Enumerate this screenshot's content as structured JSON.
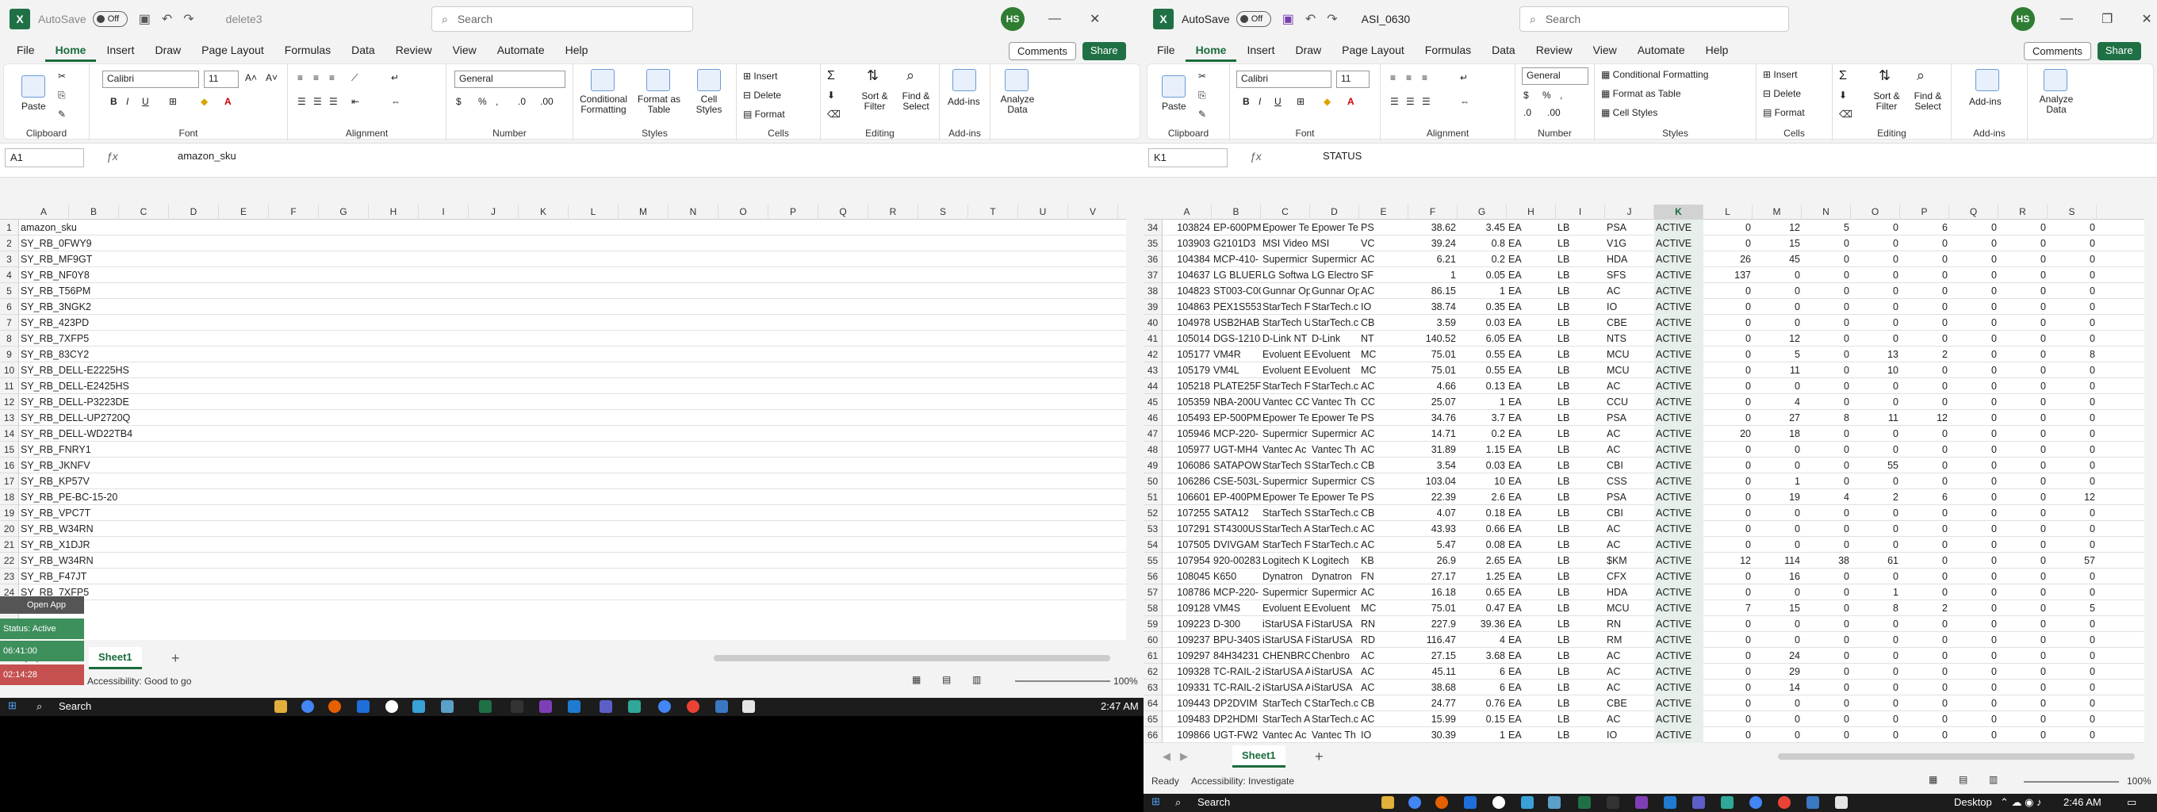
{
  "left_window": {
    "autosave_label": "AutoSave",
    "autosave_state": "Off",
    "filename": "delete3",
    "search_placeholder": "Search",
    "avatar": "HS",
    "menu": [
      "File",
      "Home",
      "Insert",
      "Draw",
      "Page Layout",
      "Formulas",
      "Data",
      "Review",
      "View",
      "Automate",
      "Help"
    ],
    "comments": "Comments",
    "share": "Share",
    "ribbon": {
      "paste": "Paste",
      "font_name": "Calibri",
      "font_size": "11",
      "number_format": "General",
      "cond_format": "Conditional Formatting",
      "format_table": "Format as Table",
      "cell_styles": "Cell Styles",
      "insert": "Insert",
      "delete": "Delete",
      "format": "Format",
      "sort_filter": "Sort & Filter",
      "find_select": "Find & Select",
      "addins": "Add-ins",
      "analyze": "Analyze Data",
      "groups": [
        "Clipboard",
        "Font",
        "Alignment",
        "Number",
        "Styles",
        "Cells",
        "Editing",
        "Add-ins"
      ]
    },
    "namebox": "A1",
    "formula": "amazon_sku",
    "columns": [
      "A",
      "B",
      "C",
      "D",
      "E",
      "F",
      "G",
      "H",
      "I",
      "J",
      "K",
      "L",
      "M",
      "N",
      "O",
      "P",
      "Q",
      "R",
      "S",
      "T",
      "U",
      "V"
    ],
    "rows": [
      "amazon_sku",
      "SY_RB_0FWY9",
      "SY_RB_MF9GT",
      "SY_RB_NF0Y8",
      "SY_RB_T56PM",
      "SY_RB_3NGK2",
      "SY_RB_423PD",
      "SY_RB_7XFP5",
      "SY_RB_83CY2",
      "SY_RB_DELL-E2225HS",
      "SY_RB_DELL-E2425HS",
      "SY_RB_DELL-P3223DE",
      "SY_RB_DELL-UP2720Q",
      "SY_RB_DELL-WD22TB4",
      "SY_RB_FNRY1",
      "SY_RB_JKNFV",
      "SY_RB_KP57V",
      "SY_RB_PE-BC-15-20",
      "SY_RB_VPC7T",
      "SY_RB_W34RN",
      "SY_RB_X1DJR",
      "SY_RB_W34RN",
      "SY_RB_F47JT",
      "SY_RB_7XFP5"
    ],
    "sheet_tab": "Sheet1",
    "accessibility": "Accessibility: Good to go",
    "zoom": "100%",
    "taskbar_search": "Search",
    "clock": "2:47 AM",
    "overlay_open": "Open App",
    "overlay_status": "Status: Active",
    "overlay_time1": "06:41:00",
    "overlay_time2": "02:14:28"
  },
  "right_window": {
    "autosave_label": "AutoSave",
    "autosave_state": "Off",
    "filename": "ASI_0630",
    "search_placeholder": "Search",
    "avatar": "HS",
    "menu": [
      "File",
      "Home",
      "Insert",
      "Draw",
      "Page Layout",
      "Formulas",
      "Data",
      "Review",
      "View",
      "Automate",
      "Help"
    ],
    "comments": "Comments",
    "share": "Share",
    "ribbon": {
      "paste": "Paste",
      "font_name": "Calibri",
      "font_size": "11",
      "number_format": "General",
      "cond_format": "Conditional Formatting",
      "format_table": "Format as Table",
      "cell_styles": "Cell Styles",
      "insert": "Insert",
      "delete": "Delete",
      "format": "Format",
      "sort_filter": "Sort & Filter",
      "find_select": "Find & Select",
      "addins": "Add-ins",
      "analyze": "Analyze Data",
      "groups": [
        "Clipboard",
        "Font",
        "Alignment",
        "Number",
        "Styles",
        "Cells",
        "Editing",
        "Add-ins"
      ]
    },
    "namebox": "K1",
    "formula": "STATUS",
    "columns": [
      "A",
      "B",
      "C",
      "D",
      "E",
      "F",
      "G",
      "H",
      "I",
      "J",
      "K",
      "L",
      "M",
      "N",
      "O",
      "P",
      "Q",
      "R",
      "S"
    ],
    "row_numbers": [
      34,
      35,
      36,
      37,
      38,
      39,
      40,
      41,
      42,
      43,
      44,
      45,
      46,
      47,
      48,
      49,
      50,
      51,
      52,
      53,
      54,
      55,
      56,
      57,
      58,
      59,
      60,
      61,
      62,
      63,
      64,
      65,
      66
    ],
    "rows": [
      [
        "103824",
        "EP-600PM",
        "Epower Te",
        "Epower Te",
        "PS",
        "38.62",
        "3.45",
        "EA",
        "LB",
        "PSA",
        "ACTIVE",
        "0",
        "12",
        "5",
        "0",
        "6",
        "0",
        "0",
        "0"
      ],
      [
        "103903",
        "G2101D3",
        "MSI Video",
        "MSI",
        "VC",
        "39.24",
        "0.8",
        "EA",
        "LB",
        "V1G",
        "ACTIVE",
        "0",
        "15",
        "0",
        "0",
        "0",
        "0",
        "0",
        "0"
      ],
      [
        "104384",
        "MCP-410-",
        "Supermicr",
        "Supermicr",
        "AC",
        "6.21",
        "0.2",
        "EA",
        "LB",
        "HDA",
        "ACTIVE",
        "26",
        "45",
        "0",
        "0",
        "0",
        "0",
        "0",
        "0"
      ],
      [
        "104637",
        "LG BLUERA",
        "LG Softwa",
        "LG Electro",
        "SF",
        "1",
        "0.05",
        "EA",
        "LB",
        "SFS",
        "ACTIVE",
        "137",
        "0",
        "0",
        "0",
        "0",
        "0",
        "0",
        "0"
      ],
      [
        "104823",
        "ST003-C00",
        "Gunnar Op",
        "Gunnar Op",
        "AC",
        "86.15",
        "1",
        "EA",
        "LB",
        "AC",
        "ACTIVE",
        "0",
        "0",
        "0",
        "0",
        "0",
        "0",
        "0",
        "0"
      ],
      [
        "104863",
        "PEX1S553",
        "StarTech F",
        "StarTech.c",
        "IO",
        "38.74",
        "0.35",
        "EA",
        "LB",
        "IO",
        "ACTIVE",
        "0",
        "0",
        "0",
        "0",
        "0",
        "0",
        "0",
        "0"
      ],
      [
        "104978",
        "USB2HAB",
        "StarTech U",
        "StarTech.c",
        "CB",
        "3.59",
        "0.03",
        "EA",
        "LB",
        "CBE",
        "ACTIVE",
        "0",
        "0",
        "0",
        "0",
        "0",
        "0",
        "0",
        "0"
      ],
      [
        "105014",
        "DGS-1210-",
        "D-Link NT",
        "D-Link",
        "NT",
        "140.52",
        "6.05",
        "EA",
        "LB",
        "NTS",
        "ACTIVE",
        "0",
        "12",
        "0",
        "0",
        "0",
        "0",
        "0",
        "0"
      ],
      [
        "105177",
        "VM4R",
        "Evoluent E",
        "Evoluent",
        "MC",
        "75.01",
        "0.55",
        "EA",
        "LB",
        "MCU",
        "ACTIVE",
        "0",
        "5",
        "0",
        "13",
        "2",
        "0",
        "0",
        "8"
      ],
      [
        "105179",
        "VM4L",
        "Evoluent E",
        "Evoluent",
        "MC",
        "75.01",
        "0.55",
        "EA",
        "LB",
        "MCU",
        "ACTIVE",
        "0",
        "11",
        "0",
        "10",
        "0",
        "0",
        "0",
        "0"
      ],
      [
        "105218",
        "PLATE25F",
        "StarTech F",
        "StarTech.c",
        "AC",
        "4.66",
        "0.13",
        "EA",
        "LB",
        "AC",
        "ACTIVE",
        "0",
        "0",
        "0",
        "0",
        "0",
        "0",
        "0",
        "0"
      ],
      [
        "105359",
        "NBA-200U",
        "Vantec CC",
        "Vantec Th",
        "CC",
        "25.07",
        "1",
        "EA",
        "LB",
        "CCU",
        "ACTIVE",
        "0",
        "4",
        "0",
        "0",
        "0",
        "0",
        "0",
        "0"
      ],
      [
        "105493",
        "EP-500PM",
        "Epower Te",
        "Epower Te",
        "PS",
        "34.76",
        "3.7",
        "EA",
        "LB",
        "PSA",
        "ACTIVE",
        "0",
        "27",
        "8",
        "11",
        "12",
        "0",
        "0",
        "0"
      ],
      [
        "105946",
        "MCP-220-",
        "Supermicr",
        "Supermicr",
        "AC",
        "14.71",
        "0.2",
        "EA",
        "LB",
        "AC",
        "ACTIVE",
        "20",
        "18",
        "0",
        "0",
        "0",
        "0",
        "0",
        "0"
      ],
      [
        "105977",
        "UGT-MH4",
        "Vantec Ac",
        "Vantec Th",
        "AC",
        "31.89",
        "1.15",
        "EA",
        "LB",
        "AC",
        "ACTIVE",
        "0",
        "0",
        "0",
        "0",
        "0",
        "0",
        "0",
        "0"
      ],
      [
        "106086",
        "SATAPOW",
        "StarTech S",
        "StarTech.c",
        "CB",
        "3.54",
        "0.03",
        "EA",
        "LB",
        "CBI",
        "ACTIVE",
        "0",
        "0",
        "0",
        "55",
        "0",
        "0",
        "0",
        "0"
      ],
      [
        "106286",
        "CSE-503L-",
        "Supermicr",
        "Supermicr",
        "CS",
        "103.04",
        "10",
        "EA",
        "LB",
        "CSS",
        "ACTIVE",
        "0",
        "1",
        "0",
        "0",
        "0",
        "0",
        "0",
        "0"
      ],
      [
        "106601",
        "EP-400PM",
        "Epower Te",
        "Epower Te",
        "PS",
        "22.39",
        "2.6",
        "EA",
        "LB",
        "PSA",
        "ACTIVE",
        "0",
        "19",
        "4",
        "2",
        "6",
        "0",
        "0",
        "12"
      ],
      [
        "107255",
        "SATA12",
        "StarTech S",
        "StarTech.c",
        "CB",
        "4.07",
        "0.18",
        "EA",
        "LB",
        "CBI",
        "ACTIVE",
        "0",
        "0",
        "0",
        "0",
        "0",
        "0",
        "0",
        "0"
      ],
      [
        "107291",
        "ST4300USI",
        "StarTech A",
        "StarTech.c",
        "AC",
        "43.93",
        "0.66",
        "EA",
        "LB",
        "AC",
        "ACTIVE",
        "0",
        "0",
        "0",
        "0",
        "0",
        "0",
        "0",
        "0"
      ],
      [
        "107505",
        "DVIVGAM",
        "StarTech F",
        "StarTech.c",
        "AC",
        "5.47",
        "0.08",
        "EA",
        "LB",
        "AC",
        "ACTIVE",
        "0",
        "0",
        "0",
        "0",
        "0",
        "0",
        "0",
        "0"
      ],
      [
        "107954",
        "920-00283",
        "Logitech K",
        "Logitech",
        "KB",
        "26.9",
        "2.65",
        "EA",
        "LB",
        "$KM",
        "ACTIVE",
        "12",
        "114",
        "38",
        "61",
        "0",
        "0",
        "0",
        "57"
      ],
      [
        "108045",
        "K650",
        "Dynatron",
        "Dynatron",
        "FN",
        "27.17",
        "1.25",
        "EA",
        "LB",
        "CFX",
        "ACTIVE",
        "0",
        "16",
        "0",
        "0",
        "0",
        "0",
        "0",
        "0"
      ],
      [
        "108786",
        "MCP-220-",
        "Supermicr",
        "Supermicr",
        "AC",
        "16.18",
        "0.65",
        "EA",
        "LB",
        "HDA",
        "ACTIVE",
        "0",
        "0",
        "0",
        "1",
        "0",
        "0",
        "0",
        "0"
      ],
      [
        "109128",
        "VM4S",
        "Evoluent E",
        "Evoluent",
        "MC",
        "75.01",
        "0.47",
        "EA",
        "LB",
        "MCU",
        "ACTIVE",
        "7",
        "15",
        "0",
        "8",
        "2",
        "0",
        "0",
        "5"
      ],
      [
        "109223",
        "D-300",
        "iStarUSA F",
        "iStarUSA",
        "RN",
        "227.9",
        "39.36",
        "EA",
        "LB",
        "RN",
        "ACTIVE",
        "0",
        "0",
        "0",
        "0",
        "0",
        "0",
        "0",
        "0"
      ],
      [
        "109237",
        "BPU-340S",
        "iStarUSA F",
        "iStarUSA",
        "RD",
        "116.47",
        "4",
        "EA",
        "LB",
        "RM",
        "ACTIVE",
        "0",
        "0",
        "0",
        "0",
        "0",
        "0",
        "0",
        "0"
      ],
      [
        "109297",
        "84H34231",
        "CHENBRO",
        "Chenbro",
        "AC",
        "27.15",
        "3.68",
        "EA",
        "LB",
        "AC",
        "ACTIVE",
        "0",
        "24",
        "0",
        "0",
        "0",
        "0",
        "0",
        "0"
      ],
      [
        "109328",
        "TC-RAIL-2",
        "iStarUSA A",
        "iStarUSA",
        "AC",
        "45.11",
        "6",
        "EA",
        "LB",
        "AC",
        "ACTIVE",
        "0",
        "29",
        "0",
        "0",
        "0",
        "0",
        "0",
        "0"
      ],
      [
        "109331",
        "TC-RAIL-2",
        "iStarUSA A",
        "iStarUSA",
        "AC",
        "38.68",
        "6",
        "EA",
        "LB",
        "AC",
        "ACTIVE",
        "0",
        "14",
        "0",
        "0",
        "0",
        "0",
        "0",
        "0"
      ],
      [
        "109443",
        "DP2DVIM",
        "StarTech C",
        "StarTech.c",
        "CB",
        "24.77",
        "0.76",
        "EA",
        "LB",
        "CBE",
        "ACTIVE",
        "0",
        "0",
        "0",
        "0",
        "0",
        "0",
        "0",
        "0"
      ],
      [
        "109483",
        "DP2HDMI",
        "StarTech A",
        "StarTech.c",
        "AC",
        "15.99",
        "0.15",
        "EA",
        "LB",
        "AC",
        "ACTIVE",
        "0",
        "0",
        "0",
        "0",
        "0",
        "0",
        "0",
        "0"
      ],
      [
        "109866",
        "UGT-FW2",
        "Vantec Ac",
        "Vantec Th",
        "IO",
        "30.39",
        "1",
        "EA",
        "LB",
        "IO",
        "ACTIVE",
        "0",
        "0",
        "0",
        "0",
        "0",
        "0",
        "0",
        "0"
      ]
    ],
    "sheet_tab": "Sheet1",
    "ready": "Ready",
    "accessibility": "Accessibility: Investigate",
    "zoom": "100%",
    "taskbar_search": "Search",
    "desktop": "Desktop",
    "clock": "2:46 AM"
  }
}
